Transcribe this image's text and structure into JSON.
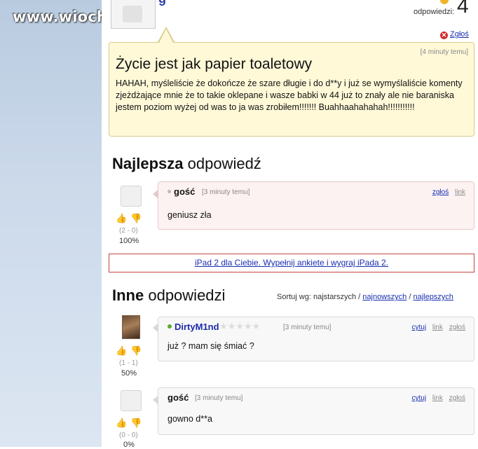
{
  "watermark": "www.wiocha.pl",
  "question": {
    "author_fragment": "g",
    "answers_label": "odpowiedzi:",
    "answers_count": "4",
    "report_label": "Zgłoś",
    "time": "[4 minuty temu]",
    "title": "Życie jest jak papier toaletowy",
    "body": "HAHAH, myśleliście że dokończe że szare długie i do d**y i już se wymyślaliście komenty zjeżdżające mnie że to takie oklepane i wasze babki w 44 już to znały ale nie baraniska jestem poziom wyżej od was to ja was zrobiłem!!!!!!! Buahhaahahahah!!!!!!!!!!!"
  },
  "best": {
    "heading_bold": "Najlepsza",
    "heading_rest": " odpowiedź",
    "answer": {
      "author": "gość",
      "time": "[3 minuty temu]",
      "text": "geniusz zła",
      "link_report": "zgłoś",
      "link_link": "link",
      "score": "(2 - 0)",
      "percent": "100%"
    }
  },
  "promo": {
    "text": "iPad 2 dla Ciebie. Wypełnij ankiete i wygraj iPada 2."
  },
  "others": {
    "heading_bold": "Inne",
    "heading_rest": " odpowiedzi",
    "sort_label": "Sortuj wg: najstarszych /",
    "sort_newest": "najnowszych",
    "sort_sep": "/",
    "sort_best": "najlepszych",
    "answers": [
      {
        "author": "DirtyM1nd",
        "stars": "★★★★★",
        "time": "[3 minuty temu]",
        "text": "już ? mam się śmiać ?",
        "link_quote": "cytuj",
        "link_link": "link",
        "link_report": "zgłoś",
        "score": "(1 - 1)",
        "percent": "50%"
      },
      {
        "author": "gość",
        "time": "[3 minuty temu]",
        "text": "gowno d**a",
        "link_quote": "cytuj",
        "link_link": "link",
        "link_report": "zgłoś",
        "score": "(0 - 0)",
        "percent": "0%"
      }
    ]
  },
  "icons": {
    "thumb_up": "👍",
    "thumb_down": "👎",
    "report": "✕"
  },
  "colors": {
    "link": "#1a2fb0",
    "best_bg": "#fdf2f2",
    "question_bg": "#fff9d8",
    "promo_border": "#c84343"
  }
}
